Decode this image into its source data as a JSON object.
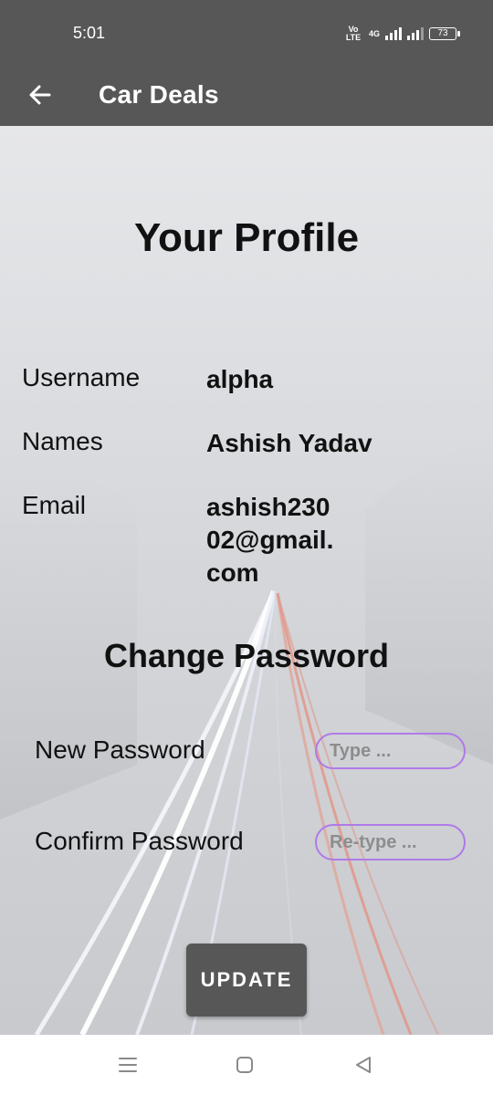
{
  "status_bar": {
    "time": "5:01",
    "network_label": "4G",
    "battery": "73"
  },
  "app_bar": {
    "title": "Car Deals",
    "back_icon": "arrow-left-icon"
  },
  "profile": {
    "title": "Your Profile",
    "rows": [
      {
        "label": "Username",
        "value": "alpha"
      },
      {
        "label": "Names",
        "value": "Ashish Yadav"
      },
      {
        "label": "Email",
        "value": "ashish23002@gmail.com"
      }
    ]
  },
  "change_password": {
    "title": "Change Password",
    "new_label": "New Password",
    "new_placeholder": "Type ...",
    "new_value": "",
    "confirm_label": "Confirm Password",
    "confirm_placeholder": "Re-type ...",
    "confirm_value": ""
  },
  "actions": {
    "update_label": "UPDATE"
  },
  "colors": {
    "bar": "#575757",
    "input_border": "#b07ae8"
  },
  "nav": {
    "menu_icon": "menu-icon",
    "home_icon": "home-square-icon",
    "back_icon": "back-triangle-icon"
  }
}
